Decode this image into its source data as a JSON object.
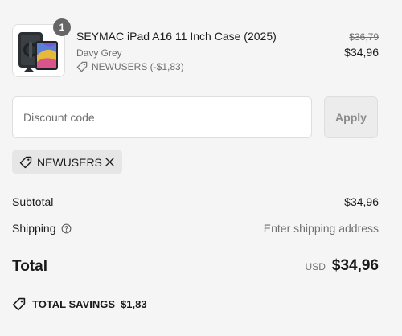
{
  "product": {
    "quantity": "1",
    "title": "SEYMAC iPad A16 11 Inch Case (2025)",
    "variant": "Davy Grey",
    "discount_note": "NEWUSERS (-$1,83)",
    "original_price": "$36,79",
    "price": "$34,96"
  },
  "discount": {
    "placeholder": "Discount code",
    "value": "",
    "apply_label": "Apply",
    "applied_code": "NEWUSERS"
  },
  "summary": {
    "subtotal_label": "Subtotal",
    "subtotal_value": "$34,96",
    "shipping_label": "Shipping",
    "shipping_value": "Enter shipping address",
    "total_label": "Total",
    "currency": "USD",
    "total_value": "$34,96",
    "savings_label": "TOTAL SAVINGS",
    "savings_value": "$1,83"
  },
  "icons": {
    "tag": "tag-icon",
    "close": "close-icon",
    "help": "help-circle-icon"
  },
  "colors": {
    "badge": "#666666",
    "muted_text": "#707070",
    "chip_background": "#e6e6e6"
  }
}
